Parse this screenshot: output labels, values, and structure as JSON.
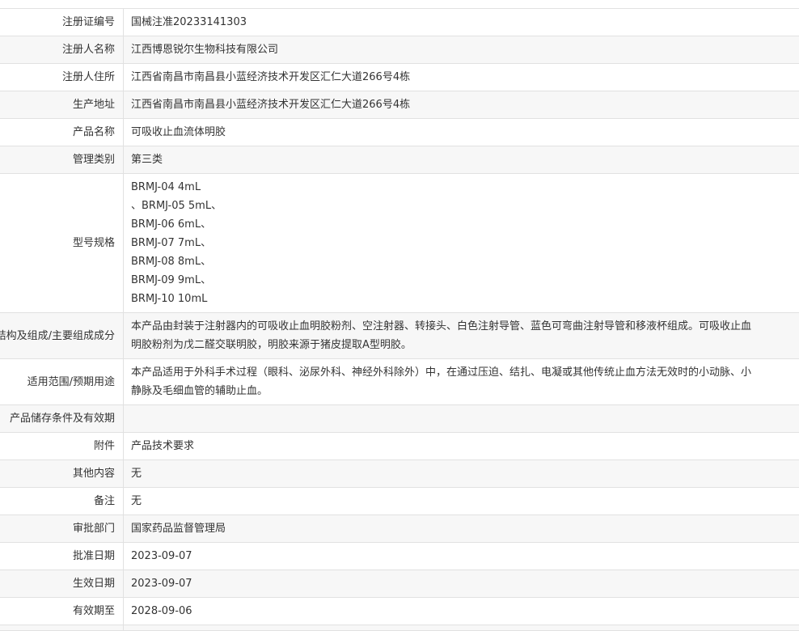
{
  "rows": [
    {
      "label": "注册证编号",
      "value": "国械注准20233141303"
    },
    {
      "label": "注册人名称",
      "value": "江西博恩锐尔生物科技有限公司"
    },
    {
      "label": "注册人住所",
      "value": "江西省南昌市南昌县小蓝经济技术开发区汇仁大道266号4栋"
    },
    {
      "label": "生产地址",
      "value": "江西省南昌市南昌县小蓝经济技术开发区汇仁大道266号4栋"
    },
    {
      "label": "产品名称",
      "value": "可吸收止血流体明胶"
    },
    {
      "label": "管理类别",
      "value": "第三类"
    },
    {
      "label": "型号规格",
      "lines": [
        "BRMJ-04 4mL",
        "、BRMJ-05 5mL、",
        "BRMJ-06 6mL、",
        "BRMJ-07 7mL、",
        "BRMJ-08 8mL、",
        "BRMJ-09 9mL、",
        "BRMJ-10 10mL"
      ]
    },
    {
      "label": "结构及组成/主要组成成分",
      "value": "本产品由封装于注射器内的可吸收止血明胶粉剂、空注射器、转接头、白色注射导管、蓝色可弯曲注射导管和移液杯组成。可吸收止血明胶粉剂为戊二醛交联明胶，明胶来源于猪皮提取A型明胶。"
    },
    {
      "label": "适用范围/预期用途",
      "value": "本产品适用于外科手术过程（眼科、泌尿外科、神经外科除外）中，在通过压迫、结扎、电凝或其他传统止血方法无效时的小动脉、小静脉及毛细血管的辅助止血。"
    },
    {
      "label": "产品储存条件及有效期",
      "value": ""
    },
    {
      "label": "附件",
      "value": "产品技术要求"
    },
    {
      "label": "其他内容",
      "value": "无"
    },
    {
      "label": "备注",
      "value": "无"
    },
    {
      "label": "审批部门",
      "value": "国家药品监督管理局"
    },
    {
      "label": "批准日期",
      "value": "2023-09-07"
    },
    {
      "label": "生效日期",
      "value": "2023-09-07"
    },
    {
      "label": "有效期至",
      "value": "2028-09-06"
    }
  ]
}
